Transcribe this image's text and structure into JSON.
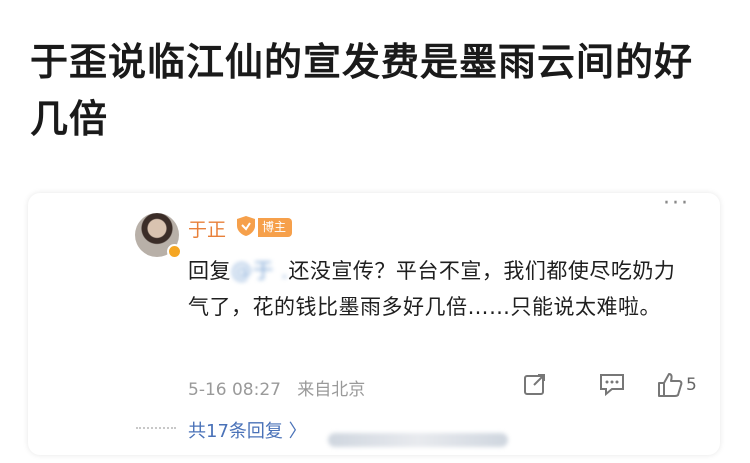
{
  "headline": "于歪说临江仙的宣发费是墨雨云间的好几倍",
  "comment_card": {
    "more_menu": "···",
    "author": "于正",
    "role_badge": "博主",
    "reply_prefix": "回复",
    "mention": "@于 .",
    "body": "还没宣传？平台不宣，我们都使尽吃奶力气了，花的钱比墨雨多好几倍……只能说太难啦。",
    "timestamp": "5-16 08:27",
    "source": "来自北京",
    "like_count": "5",
    "replies_label": "共17条回复 〉",
    "icons": [
      "repost-icon",
      "comment-icon",
      "like-icon"
    ],
    "accent_color": "#e8803a",
    "link_color": "#4a72b8"
  }
}
